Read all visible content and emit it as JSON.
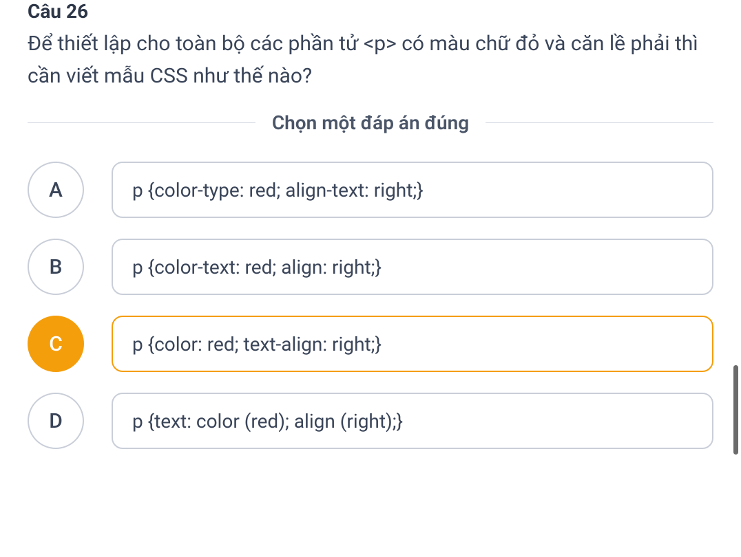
{
  "question": {
    "number": "Câu 26",
    "text": "Để thiết lập cho toàn bộ các phần tử <p> có màu chữ đỏ và căn lề phải thì cần viết mẫu CSS như thế nào?",
    "instruction": "Chọn một đáp án đúng"
  },
  "options": [
    {
      "letter": "A",
      "text": "p {color-type: red; align-text: right;}",
      "selected": false
    },
    {
      "letter": "B",
      "text": "p {color-text: red; align: right;}",
      "selected": false
    },
    {
      "letter": "C",
      "text": "p {color: red; text-align: right;}",
      "selected": true
    },
    {
      "letter": "D",
      "text": "p {text: color (red); align (right);}",
      "selected": false
    }
  ]
}
